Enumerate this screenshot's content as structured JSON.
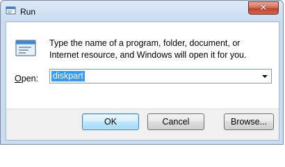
{
  "window": {
    "title": "Run",
    "close_glyph": "✕"
  },
  "dialog": {
    "description": "Type the name of a program, folder, document, or Internet resource, and Windows will open it for you.",
    "open_label_prefix": "",
    "open_label_underlined": "O",
    "open_label_rest": "pen:",
    "command_value": "diskpart"
  },
  "buttons": {
    "ok": "OK",
    "cancel": "Cancel",
    "browse": "Browse..."
  },
  "icons": {
    "title": "run-app-icon",
    "body": "run-window-icon",
    "dropdown": "chevron-down-icon"
  }
}
